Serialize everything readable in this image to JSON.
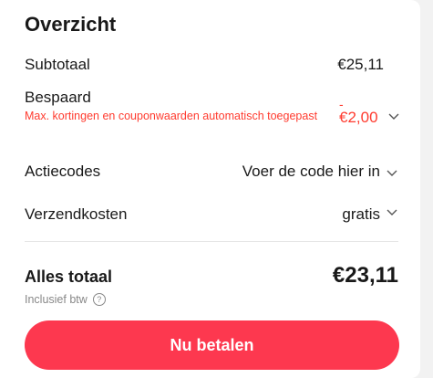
{
  "summary": {
    "title": "Overzicht",
    "subtotal_label": "Subtotaal",
    "subtotal_value": "€25,11",
    "discount_label": "Bespaard",
    "discount_note": "Max. kortingen en couponwaarden automatisch toegepast",
    "discount_sign": "-",
    "discount_value": "€2,00",
    "codes_label": "Actiecodes",
    "codes_value": "Voer de code hier in",
    "shipping_label": "Verzendkosten",
    "shipping_value": "gratis",
    "total_label": "Alles totaal",
    "total_value": "€23,11",
    "vat_label": "Inclusief btw",
    "pay_label": "Nu betalen"
  },
  "colors": {
    "accent": "#fd384f",
    "discount": "#ff3b2f"
  },
  "icons": {
    "chevron": "chevron-down-icon",
    "help": "question-circle-icon"
  }
}
